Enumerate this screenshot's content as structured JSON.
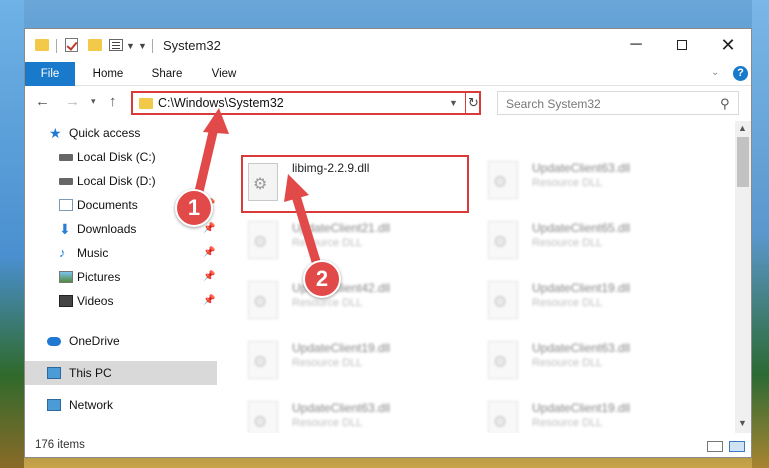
{
  "window": {
    "title": "System32"
  },
  "ribbon": {
    "tabs": [
      "File",
      "Home",
      "Share",
      "View"
    ]
  },
  "nav": {
    "address": "C:\\Windows\\System32",
    "search_placeholder": "Search System32"
  },
  "sidebar": {
    "items": [
      {
        "label": "Quick access",
        "icon": "star-icon"
      },
      {
        "label": "Local Disk (C:)",
        "icon": "drive-icon"
      },
      {
        "label": "Local Disk (D:)",
        "icon": "drive-icon"
      },
      {
        "label": "Documents",
        "icon": "documents-icon"
      },
      {
        "label": "Downloads",
        "icon": "download-icon"
      },
      {
        "label": "Music",
        "icon": "music-icon"
      },
      {
        "label": "Pictures",
        "icon": "pictures-icon"
      },
      {
        "label": "Videos",
        "icon": "videos-icon"
      },
      {
        "label": "OneDrive",
        "icon": "cloud-icon"
      },
      {
        "label": "This PC",
        "icon": "computer-icon"
      },
      {
        "label": "Network",
        "icon": "network-icon"
      }
    ]
  },
  "files": {
    "main": {
      "name": "libimg-2.2.9.dll"
    },
    "blurred": [
      {
        "name": "UpdateClient63.dll",
        "desc": "Resource DLL"
      },
      {
        "name": "UpdateClient21.dll",
        "desc": "Resource DLL"
      },
      {
        "name": "UpdateClient65.dll",
        "desc": "Resource DLL"
      },
      {
        "name": "UpdateClient42.dll",
        "desc": "Resource DLL"
      },
      {
        "name": "UpdateClient19.dll",
        "desc": "Resource DLL"
      },
      {
        "name": "UpdateClient19.dll",
        "desc": "Resource DLL"
      },
      {
        "name": "UpdateClient63.dll",
        "desc": "Resource DLL"
      },
      {
        "name": "UpdateClient63.dll",
        "desc": "Resource DLL"
      },
      {
        "name": "UpdateClient19.dll",
        "desc": "Resource DLL"
      }
    ]
  },
  "status": {
    "item_count": "176 items"
  },
  "callouts": {
    "one": "1",
    "two": "2"
  },
  "colors": {
    "accent": "#1979ca",
    "highlight": "#d93a3a"
  }
}
